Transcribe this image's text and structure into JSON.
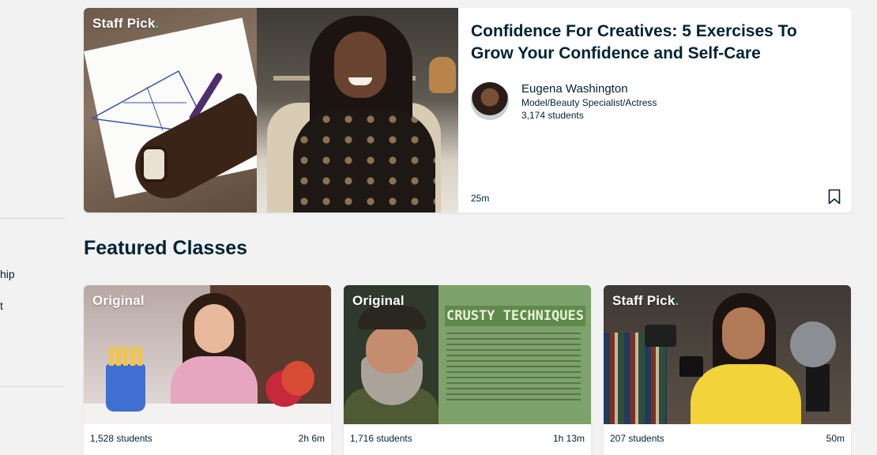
{
  "sidebar": {
    "item_ship": "hip",
    "item_t": "t"
  },
  "hero": {
    "badge_main": "Staff Pick",
    "badge_dot": ".",
    "title": "Confidence For Creatives: 5 Exercises To Grow Your Confidence and Self-Care",
    "teacher_name": "Eugena Washington",
    "teacher_role": "Model/Beauty Specialist/Actress",
    "students": "3,174 students",
    "duration": "25m",
    "bookmark_icon": "bookmark-icon"
  },
  "featured": {
    "title": "Featured Classes",
    "cards": [
      {
        "badge_main": "Original",
        "badge_dot": "",
        "students": "1,528 students",
        "duration": "2h 6m"
      },
      {
        "badge_main": "Original",
        "badge_dot": "",
        "students": "1,716 students",
        "duration": "1h 13m",
        "poster_title": "CRUSTY TECHNIQUES"
      },
      {
        "badge_main": "Staff Pick",
        "badge_dot": ".",
        "students": "207 students",
        "duration": "50m"
      }
    ]
  },
  "colors": {
    "brand_dot": "#00ff84",
    "text": "#002333",
    "background": "#f2f2f2"
  }
}
